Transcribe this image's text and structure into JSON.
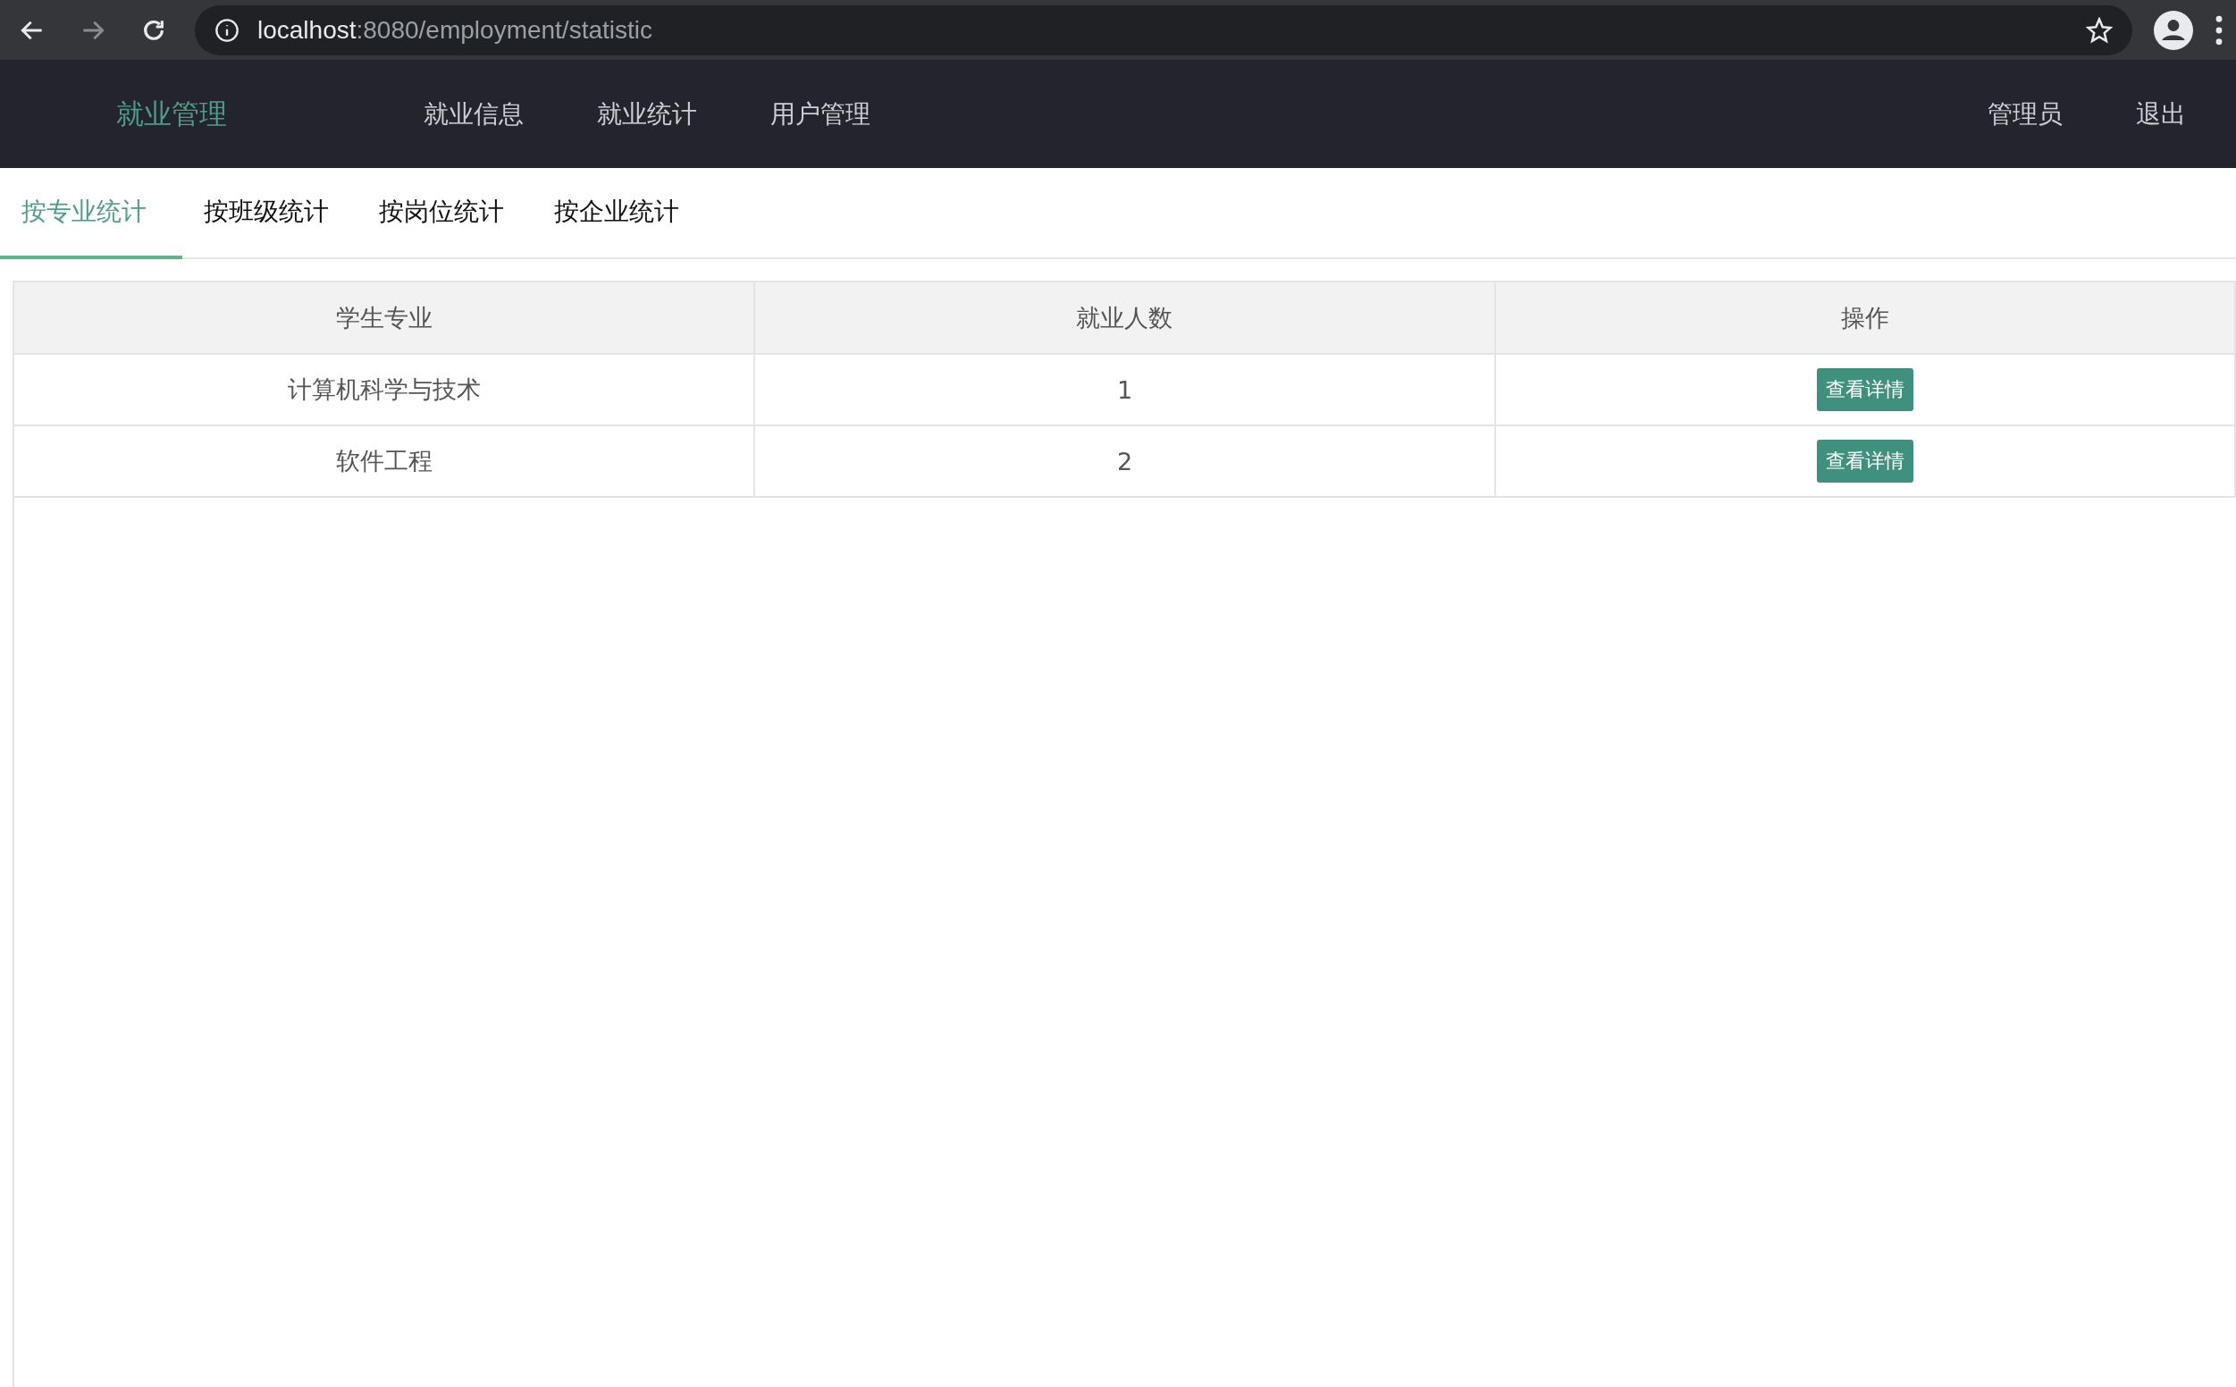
{
  "browser": {
    "url_host": "localhost",
    "url_path": ":8080/employment/statistic"
  },
  "navbar": {
    "brand": "就业管理",
    "links": [
      "就业信息",
      "就业统计",
      "用户管理"
    ],
    "user": "管理员",
    "logout": "退出"
  },
  "tabs": [
    {
      "label": "按专业统计",
      "selected": true
    },
    {
      "label": "按班级统计",
      "selected": false
    },
    {
      "label": "按岗位统计",
      "selected": false
    },
    {
      "label": "按企业统计",
      "selected": false
    }
  ],
  "table": {
    "columns": [
      "学生专业",
      "就业人数",
      "操作"
    ],
    "rows": [
      {
        "major": "计算机科学与技术",
        "count": "1",
        "action": "查看详情"
      },
      {
        "major": "软件工程",
        "count": "2",
        "action": "查看详情"
      }
    ]
  }
}
